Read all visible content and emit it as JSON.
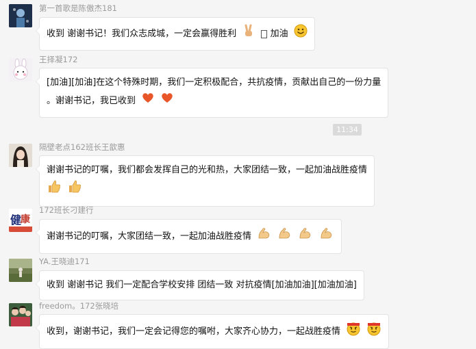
{
  "messages": [
    {
      "sender": "第一首歌是陈傲杰181",
      "lines": [
        "收到 谢谢书记！我们众志成城，一定会赢得胜利"
      ],
      "after_text": "加油",
      "emojis": [
        "victory-hand-icon",
        "smiley-icon"
      ]
    },
    {
      "sender": "王择凝172",
      "lines": [
        "[加油][加油]在这个特殊时期，我们一定积极配合，共抗疫情，贡献出自己的一份力量",
        "。谢谢书记，我已收到"
      ],
      "emojis": [
        "heart-icon",
        "heart-icon"
      ]
    },
    {
      "sender": "隔壁老点162班长王歆惠",
      "lines": [
        "谢谢书记的叮嘱，我们都会发挥自己的光和热，大家团结一致，一起加油战胜疫情"
      ],
      "emojis": [
        "thumbs-up-icon",
        "thumbs-up-icon"
      ]
    },
    {
      "sender": "172班长刁建行",
      "lines": [
        "谢谢书记的叮嘱，大家团结一致，一起加油战胜疫情"
      ],
      "emojis": [
        "flexed-biceps-icon",
        "flexed-biceps-icon",
        "flexed-biceps-icon",
        "flexed-biceps-icon"
      ]
    },
    {
      "sender": "YA.王晓迪171",
      "lines": [
        "收到 谢谢书记 我们一定配合学校安排 团结一致 对抗疫情[加油加油][加油加油]"
      ],
      "emojis": []
    },
    {
      "sender": "freedom。172张晓培",
      "lines": [
        "收到，谢谢书记，我们一定会记得您的嘱咐，大家齐心协力，一起战胜疫情"
      ],
      "emojis": [
        "fighting-face-icon",
        "fighting-face-icon"
      ]
    }
  ],
  "timestamp": "11:34"
}
